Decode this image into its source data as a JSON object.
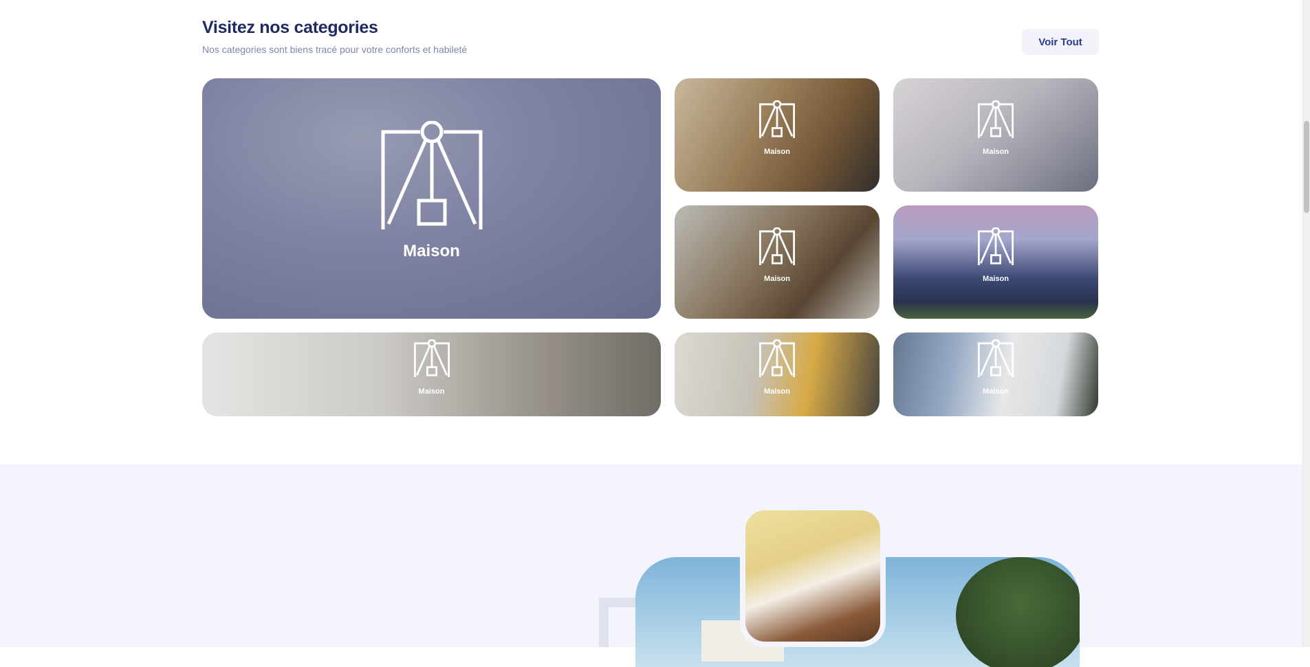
{
  "categories_section": {
    "title": "Visitez nos categories",
    "subtitle": "Nos categories sont biens tracé pour votre conforts et habileté",
    "view_all_label": "Voir Tout",
    "cards": [
      {
        "label": "Maison",
        "icon": "architecture-compass-icon"
      },
      {
        "label": "Maison",
        "icon": "architecture-compass-icon"
      },
      {
        "label": "Maison",
        "icon": "architecture-compass-icon"
      },
      {
        "label": "Maison",
        "icon": "architecture-compass-icon"
      },
      {
        "label": "Maison",
        "icon": "architecture-compass-icon"
      },
      {
        "label": "Maison",
        "icon": "architecture-compass-icon"
      },
      {
        "label": "Maison",
        "icon": "architecture-compass-icon"
      },
      {
        "label": "Maison",
        "icon": "architecture-compass-icon"
      }
    ]
  },
  "colors": {
    "title": "#1f2a63",
    "subtitle": "#7d86a8",
    "button_bg": "#f2f3fa",
    "button_text": "#2a3a8f",
    "bottom_section_bg": "#f3f4fc"
  }
}
